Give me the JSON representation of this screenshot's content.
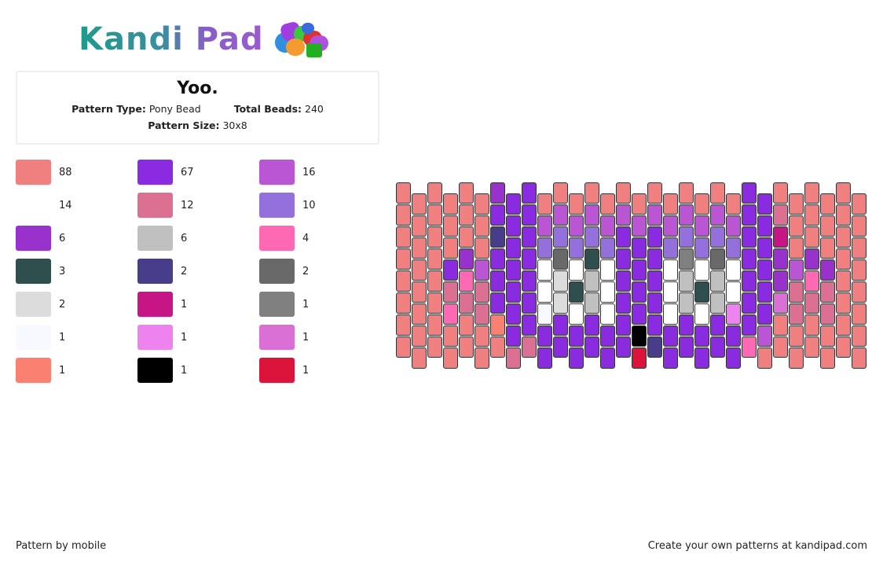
{
  "brand": {
    "name": "Kandi Pad",
    "logo_icon": "beads-logo-icon"
  },
  "pattern": {
    "title": "Yoo.",
    "type_label": "Pattern Type:",
    "type_value": "Pony Bead",
    "total_label": "Total Beads:",
    "total_value": "240",
    "size_label": "Pattern Size:",
    "size_value": "30x8"
  },
  "legend": [
    {
      "key": "S",
      "color": "#F08080",
      "count": "88"
    },
    {
      "key": "P",
      "color": "#8A2BE2",
      "count": "67"
    },
    {
      "key": "M",
      "color": "#BA55D3",
      "count": "16"
    },
    {
      "key": "W",
      "color": "#FFFFFF",
      "count": "14"
    },
    {
      "key": "R",
      "color": "#DB7093",
      "count": "12"
    },
    {
      "key": "L",
      "color": "#9370DB",
      "count": "10"
    },
    {
      "key": "D",
      "color": "#9932CC",
      "count": "6"
    },
    {
      "key": "G",
      "color": "#C0C0C0",
      "count": "6"
    },
    {
      "key": "H",
      "color": "#FF69B4",
      "count": "4"
    },
    {
      "key": "K",
      "color": "#2F4F4F",
      "count": "3"
    },
    {
      "key": "N",
      "color": "#483D8B",
      "count": "2"
    },
    {
      "key": "Y",
      "color": "#696969",
      "count": "2"
    },
    {
      "key": "Z",
      "color": "#DCDCDC",
      "count": "2"
    },
    {
      "key": "V",
      "color": "#C71585",
      "count": "1"
    },
    {
      "key": "E",
      "color": "#808080",
      "count": "1"
    },
    {
      "key": "F",
      "color": "#F8F8FF",
      "count": "1"
    },
    {
      "key": "O",
      "color": "#EE82EE",
      "count": "1"
    },
    {
      "key": "Q",
      "color": "#DA70D6",
      "count": "1"
    },
    {
      "key": "T",
      "color": "#FA8072",
      "count": "1"
    },
    {
      "key": "B",
      "color": "#000000",
      "count": "1"
    },
    {
      "key": "C",
      "color": "#DC143C",
      "count": "1"
    }
  ],
  "grid": {
    "columns": 30,
    "rows": 8,
    "style": "peyote",
    "cols": [
      "SSSSSSSS",
      "SSSSSSSS",
      "SSSSSSSS",
      "SSSPRHSS",
      "SSSDHRSS",
      "SSSMRRSS",
      "DPNPPPTS",
      "PPPPPPPR",
      "PPPPPPPR",
      "SMLWWFPP",
      "SMLYZZPP",
      "SMLWKWPP",
      "SMLKGGPP",
      "SMLWWWPP",
      "SMPPPPPP",
      "SMPPPPBC",
      "SMPPPPPN",
      "SMLWWWPP",
      "SMLEGGPP",
      "SMLWKWPP",
      "SMLYGGPP",
      "SMLWWOPP",
      "PPPPPPPH",
      "PPPPPPMS",
      "SRVDDQSS",
      "SSSMRRSS",
      "SSSDHRSS",
      "SSSDRRSS",
      "SSSSSSSS",
      "SSSSSSSS"
    ]
  },
  "footer": {
    "author": "Pattern by mobile",
    "cta": "Create your own patterns at kandipad.com"
  }
}
